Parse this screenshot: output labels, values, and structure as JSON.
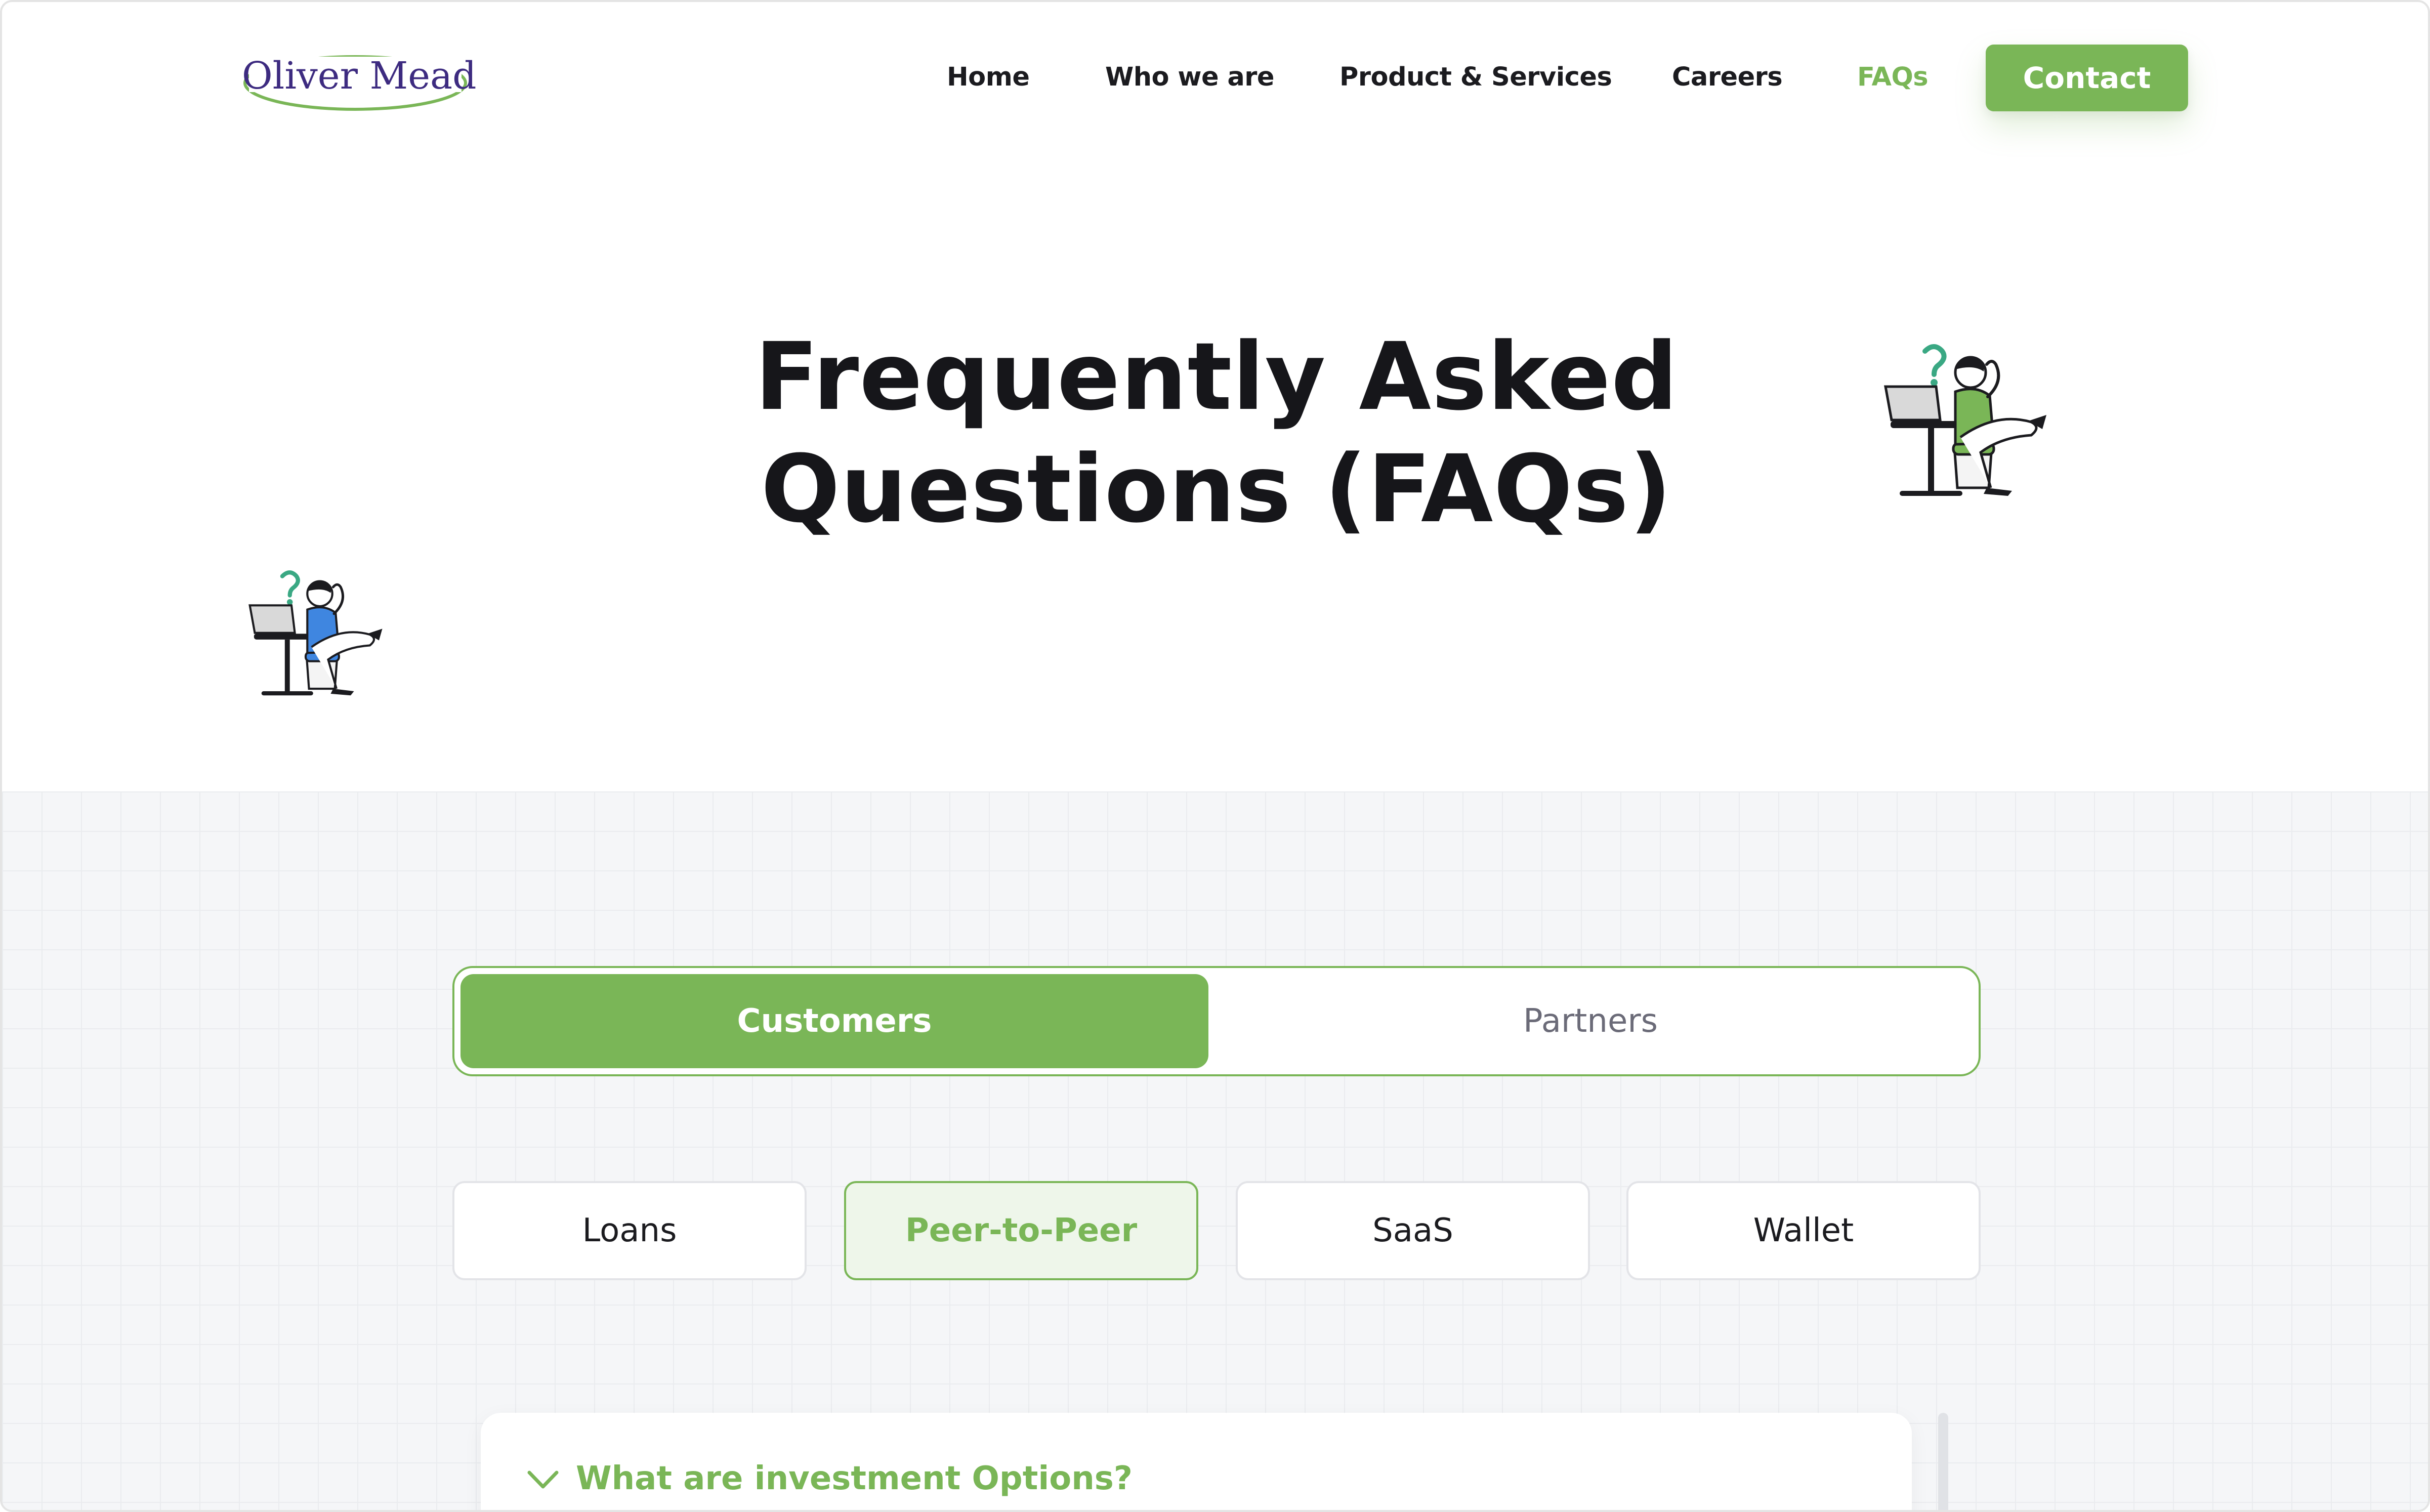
{
  "header": {
    "logo_text": "Oliver Mead",
    "nav": [
      {
        "label": "Home",
        "active": false
      },
      {
        "label": "Who we are",
        "active": false
      },
      {
        "label": "Product & Services",
        "active": false
      },
      {
        "label": "Careers",
        "active": false
      },
      {
        "label": "FAQs",
        "active": true
      }
    ],
    "contact_label": "Contact"
  },
  "hero": {
    "title_line1": "Frequently Asked",
    "title_line2": "Questions (FAQs)"
  },
  "faq": {
    "audience_tabs": [
      {
        "label": "Customers",
        "selected": true
      },
      {
        "label": "Partners",
        "selected": false
      }
    ],
    "categories": [
      {
        "label": "Loans",
        "active": false
      },
      {
        "label": "Peer-to-Peer",
        "active": true
      },
      {
        "label": "SaaS",
        "active": false
      },
      {
        "label": "Wallet",
        "active": false
      }
    ],
    "items": [
      {
        "question": "What are investment Options?",
        "expanded": false
      }
    ]
  },
  "colors": {
    "accent": "#7ab657",
    "accent_light": "#eef6ea",
    "text_dark": "#16161a",
    "text_muted": "#6b6b78",
    "section_bg": "#f5f6f8",
    "logo_purple": "#3d2b80",
    "illustration_blue": "#3f86e0"
  },
  "icons": {
    "faq_toggle": "chevron-down-icon",
    "illustration": "person-thinking-at-laptop"
  }
}
